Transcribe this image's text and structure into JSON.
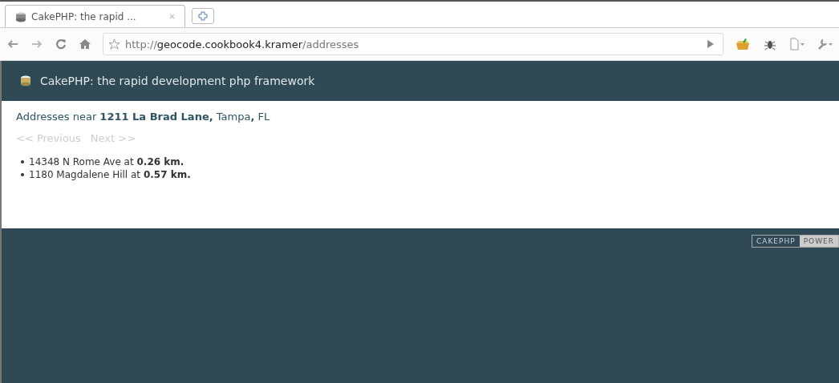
{
  "browser": {
    "tab": {
      "title": "CakePHP: the rapid ...",
      "selected": true
    },
    "address": {
      "scheme": "http://",
      "host": "geocode.cookbook4.kramer",
      "path": "/addresses"
    }
  },
  "header": {
    "title": "CakePHP: the rapid development php framework"
  },
  "content": {
    "heading": "Addresses near **1211 La Brad Lane,** Tampa**,** FL",
    "pagination": [
      {
        "label": "<< Previous",
        "disabled": true
      },
      {
        "label": "Next >>",
        "disabled": true
      }
    ],
    "results": [
      {
        "text": "14348 N Rome Ave at **0.26 km.**"
      },
      {
        "text": "1180 Magdalene Hill at **0.57 km.**"
      }
    ]
  },
  "footer": {
    "badge": [
      "CAKEPHP",
      "POWER"
    ]
  }
}
